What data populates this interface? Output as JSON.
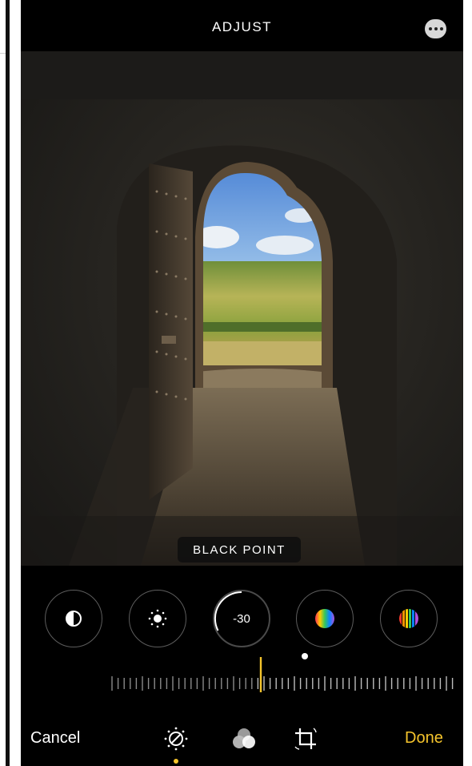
{
  "header": {
    "title": "ADJUST"
  },
  "photo": {
    "adjustment_label": "BLACK POINT"
  },
  "tools": [
    {
      "name": "exposure",
      "icon": "half-circle-icon"
    },
    {
      "name": "brilliance",
      "icon": "sun-icon"
    },
    {
      "name": "black-point",
      "icon": "value",
      "value": "-30",
      "selected": true
    },
    {
      "name": "saturation",
      "icon": "color-sphere-icon"
    },
    {
      "name": "vibrance",
      "icon": "striped-color-sphere-icon"
    }
  ],
  "slider": {
    "value": -30,
    "min": -100,
    "max": 100
  },
  "footer": {
    "cancel_label": "Cancel",
    "done_label": "Done",
    "tabs": [
      "adjust-icon",
      "filters-icon",
      "crop-icon"
    ],
    "active_tab": "adjust-icon"
  },
  "colors": {
    "accent": "#f5c42c",
    "background": "#000000"
  }
}
